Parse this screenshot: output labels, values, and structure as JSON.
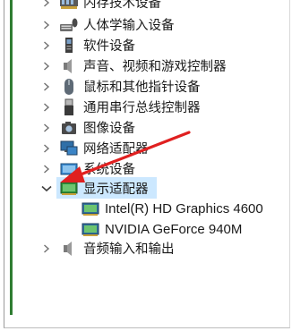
{
  "window": {
    "accent_color": "#2f7d32"
  },
  "tree": {
    "items": [
      {
        "label": "内存技术设备",
        "icon": "memory-icon",
        "state": "collapsed"
      },
      {
        "label": "人体学输入设备",
        "icon": "hid-icon",
        "state": "collapsed"
      },
      {
        "label": "软件设备",
        "icon": "software-device-icon",
        "state": "collapsed"
      },
      {
        "label": "声音、视频和游戏控制器",
        "icon": "speaker-icon",
        "state": "collapsed"
      },
      {
        "label": "鼠标和其他指针设备",
        "icon": "mouse-icon",
        "state": "collapsed"
      },
      {
        "label": "通用串行总线控制器",
        "icon": "usb-icon",
        "state": "collapsed"
      },
      {
        "label": "图像设备",
        "icon": "camera-icon",
        "state": "collapsed"
      },
      {
        "label": "网络适配器",
        "icon": "network-icon",
        "state": "collapsed"
      },
      {
        "label": "系统设备",
        "icon": "system-device-icon",
        "state": "collapsed"
      },
      {
        "label": "显示适配器",
        "icon": "display-adapter-icon",
        "state": "expanded",
        "selected": true
      },
      {
        "label": "Intel(R) HD Graphics 4600",
        "icon": "display-adapter-icon",
        "child": true
      },
      {
        "label": "NVIDIA GeForce 940M",
        "icon": "display-adapter-icon",
        "child": true
      },
      {
        "label": "音频输入和输出",
        "icon": "speaker-icon",
        "state": "collapsed"
      }
    ]
  },
  "annotation": {
    "color": "#e02020"
  }
}
